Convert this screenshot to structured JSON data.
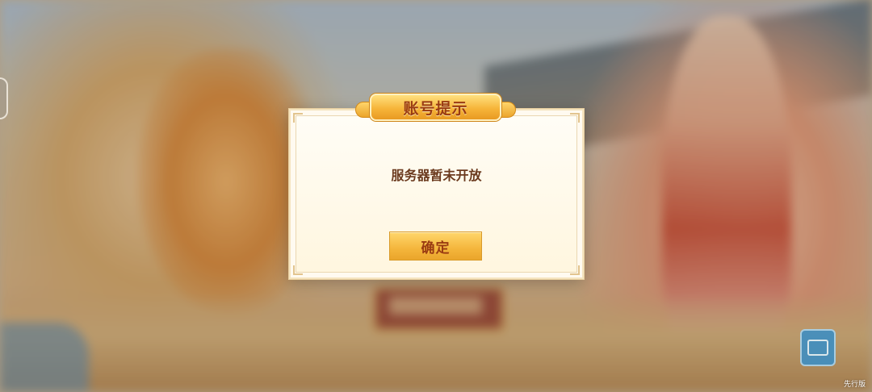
{
  "dialog": {
    "title": "账号提示",
    "message": "服务器暂未开放",
    "confirm_label": "确定"
  },
  "footer": {
    "version_label": "先行版"
  },
  "icons": {
    "side_tab": "side-tab-handle-icon",
    "corner_widget": "notice-board-icon"
  },
  "colors": {
    "dialog_bg": "#fffaf0",
    "ribbon_gold": "#f6b53a",
    "title_text": "#9a3b12",
    "message_text": "#6b3a1e"
  }
}
